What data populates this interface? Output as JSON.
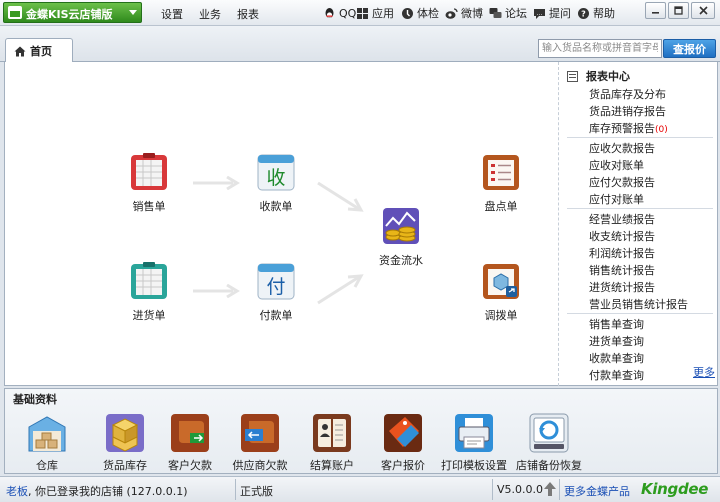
{
  "titlebar": {
    "app_title": "金蝶KIS云店铺版",
    "menu": [
      "设置",
      "业务",
      "报表"
    ],
    "tools": [
      {
        "label": "QQ",
        "icon": "qq-icon"
      },
      {
        "label": "应用",
        "icon": "apps-icon"
      },
      {
        "label": "体检",
        "icon": "checkup-icon"
      },
      {
        "label": "微博",
        "icon": "weibo-icon"
      },
      {
        "label": "论坛",
        "icon": "forum-icon"
      },
      {
        "label": "提问",
        "icon": "question-icon"
      },
      {
        "label": "帮助",
        "icon": "help-icon"
      }
    ]
  },
  "tabs": {
    "home_label": "首页",
    "search_placeholder": "输入货品名称或拼音首字母",
    "price_button": "查报价"
  },
  "flow": {
    "sales_order": "销售单",
    "receipt": "收款单",
    "stocktake": "盘点单",
    "cash_flow": "资金流水",
    "purchase_order": "进货单",
    "payment": "付款单",
    "transfer": "调拨单",
    "receipt_glyph": "收",
    "payment_glyph": "付"
  },
  "reports": {
    "title": "报表中心",
    "groups": [
      [
        "货品库存及分布",
        "货品进销存报告",
        "库存预警报告"
      ],
      [
        "应收欠款报告",
        "应收对账单",
        "应付欠款报告",
        "应付对账单"
      ],
      [
        "经营业绩报告",
        "收支统计报告",
        "利润统计报告",
        "销售统计报告",
        "进货统计报告",
        "营业员销售统计报告"
      ],
      [
        "销售单查询",
        "进货单查询",
        "收款单查询",
        "付款单查询"
      ]
    ],
    "warning_count": "(0)",
    "more_label": "更多"
  },
  "base_data": {
    "title": "基础资料",
    "items": [
      "仓库",
      "货品库存",
      "客户欠款",
      "供应商欠款",
      "结算账户",
      "客户报价",
      "打印模板设置",
      "店铺备份恢复"
    ]
  },
  "status": {
    "user": "老板",
    "login_text": ", 你已登录我的店铺 (127.0.0.1)",
    "edition": "正式版",
    "version": "V5.0.0.0",
    "more_products": "更多金蝶产品",
    "brand": "Kingdee"
  },
  "colors": {
    "brand_green": "#2d9c1e",
    "link_blue": "#1a4fb5",
    "price_button": "#1f6fc2",
    "warning_red": "#e60000"
  }
}
